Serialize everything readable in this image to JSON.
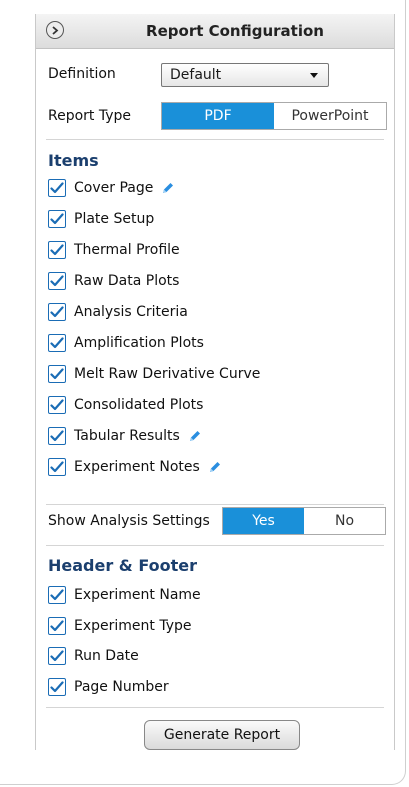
{
  "header": {
    "title": "Report Configuration",
    "collapse_icon": "chevron-right-circle-icon"
  },
  "definition": {
    "label": "Definition",
    "selected": "Default"
  },
  "report_type": {
    "label": "Report Type",
    "options": [
      "PDF",
      "PowerPoint"
    ],
    "selected": "PDF"
  },
  "items": {
    "title": "Items",
    "list": [
      {
        "label": "Cover Page",
        "checked": true,
        "editable": true
      },
      {
        "label": "Plate Setup",
        "checked": true,
        "editable": false
      },
      {
        "label": "Thermal Profile",
        "checked": true,
        "editable": false
      },
      {
        "label": "Raw Data Plots",
        "checked": true,
        "editable": false
      },
      {
        "label": "Analysis Criteria",
        "checked": true,
        "editable": false
      },
      {
        "label": "Amplification Plots",
        "checked": true,
        "editable": false
      },
      {
        "label": "Melt Raw Derivative Curve",
        "checked": true,
        "editable": false
      },
      {
        "label": "Consolidated Plots",
        "checked": true,
        "editable": false
      },
      {
        "label": "Tabular Results",
        "checked": true,
        "editable": true
      },
      {
        "label": "Experiment Notes",
        "checked": true,
        "editable": true
      }
    ]
  },
  "analysis_settings": {
    "label": "Show Analysis Settings",
    "options": [
      "Yes",
      "No"
    ],
    "selected": "Yes"
  },
  "header_footer": {
    "title": "Header & Footer",
    "list": [
      {
        "label": "Experiment Name",
        "checked": true
      },
      {
        "label": "Experiment Type",
        "checked": true
      },
      {
        "label": "Run Date",
        "checked": true
      },
      {
        "label": "Page Number",
        "checked": true
      }
    ]
  },
  "generate_button": {
    "label": "Generate Report"
  },
  "colors": {
    "accent": "#1a90d9",
    "section_title": "#1b3f6e",
    "check": "#1a6cb5",
    "pencil": "#2a8ee0"
  }
}
